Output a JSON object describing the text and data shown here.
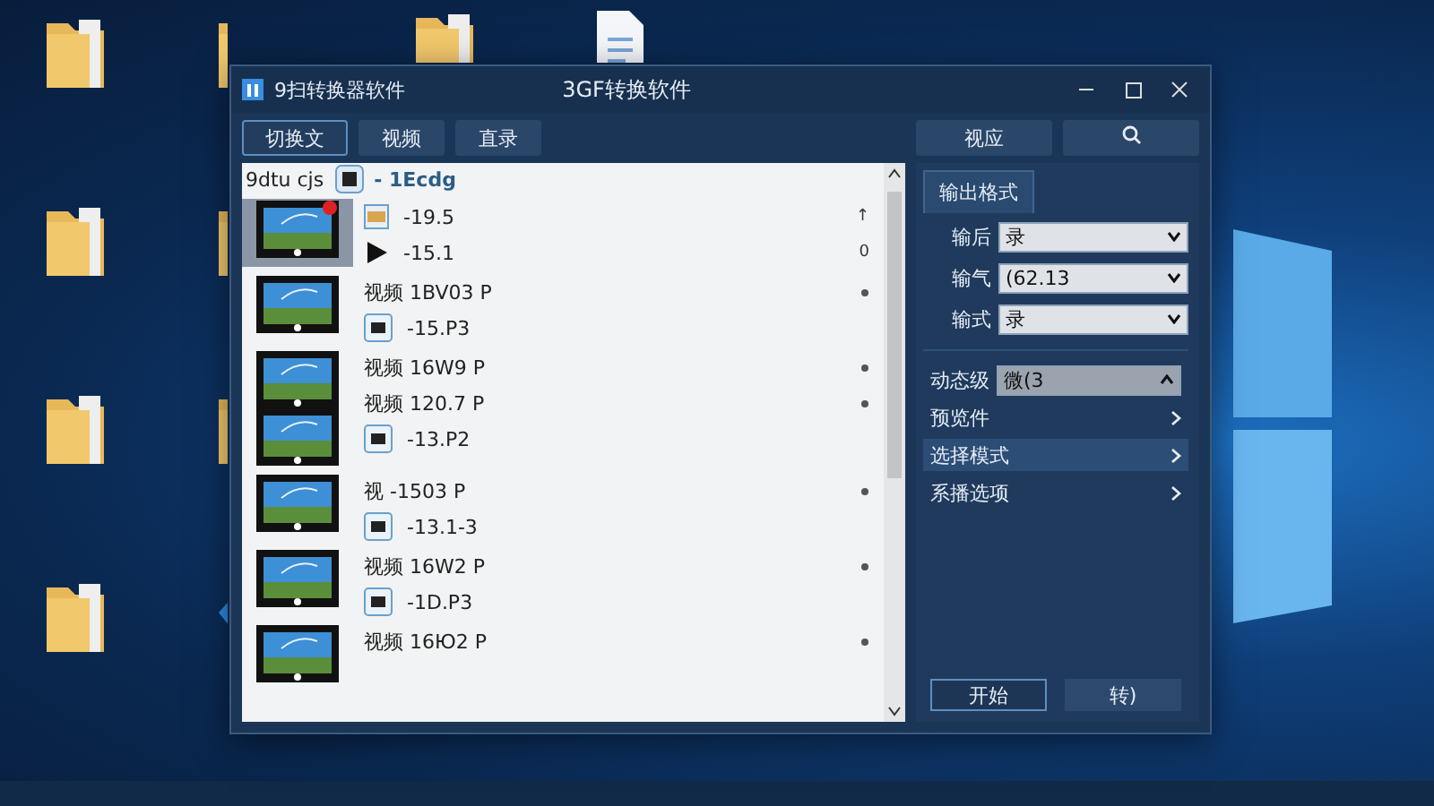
{
  "desktop": {
    "icons": [
      {
        "kind": "folder"
      },
      {
        "kind": "folder"
      },
      {
        "kind": "folder"
      },
      {
        "kind": "folder"
      },
      {
        "kind": "folder"
      },
      {
        "kind": "folder"
      },
      {
        "kind": "folder"
      },
      {
        "kind": "app"
      },
      {
        "kind": "folder"
      },
      {
        "kind": "document"
      }
    ]
  },
  "window": {
    "app_name": "9扫转换器软件",
    "title": "3GF转换软件"
  },
  "toolbar": {
    "tabs": [
      {
        "label": "切换文",
        "selected": true
      },
      {
        "label": "视频",
        "selected": false
      },
      {
        "label": "直录",
        "selected": false
      }
    ],
    "action": "视应"
  },
  "file_list": {
    "header": {
      "column_1": "9dtu cjs",
      "column_2": "- 1Ecdg"
    },
    "items": [
      {
        "selected": true,
        "double_thumbnail": false,
        "badge": true,
        "lines": [
          {
            "kind": "film",
            "text": "-19.5",
            "side": "↑"
          },
          {
            "kind": "play",
            "text": "-15.1",
            "side": "0"
          }
        ]
      },
      {
        "selected": false,
        "double_thumbnail": false,
        "badge": false,
        "lines": [
          {
            "kind": "title",
            "text": "视频 1BV03 P"
          },
          {
            "kind": "meta",
            "text": "-15.P3"
          }
        ]
      },
      {
        "selected": false,
        "double_thumbnail": true,
        "badge": false,
        "lines": [
          {
            "kind": "title",
            "text": "视频 16W9 P"
          },
          {
            "kind": "title",
            "text": "视频 120.7 P"
          },
          {
            "kind": "meta",
            "text": "-13.P2"
          }
        ]
      },
      {
        "selected": false,
        "double_thumbnail": false,
        "badge": false,
        "lines": [
          {
            "kind": "title",
            "text": "视 -1503 P"
          },
          {
            "kind": "meta",
            "text": "-13.1-3"
          }
        ]
      },
      {
        "selected": false,
        "double_thumbnail": false,
        "badge": false,
        "lines": [
          {
            "kind": "title",
            "text": "视频 16W2 P"
          },
          {
            "kind": "meta",
            "text": "-1D.P3"
          }
        ]
      },
      {
        "selected": false,
        "double_thumbnail": false,
        "badge": false,
        "lines": [
          {
            "kind": "title",
            "text": "视频 16Ю2 P"
          }
        ]
      }
    ]
  },
  "settings": {
    "tab": "输出格式",
    "fields": [
      {
        "label": "输后",
        "value": "录"
      },
      {
        "label": "输气",
        "value": "(62.13"
      },
      {
        "label": "输式",
        "value": "录"
      }
    ],
    "options": [
      {
        "kind": "dropdown",
        "label": "动态级",
        "value": "微(3",
        "expanded": true
      },
      {
        "kind": "link",
        "label": "预览件",
        "selected": false
      },
      {
        "kind": "link",
        "label": "选择模式",
        "selected": true
      },
      {
        "kind": "link",
        "label": "系播选项",
        "selected": false
      }
    ],
    "buttons": [
      {
        "label": "开始",
        "selected": true
      },
      {
        "label": "转)",
        "selected": false
      }
    ]
  }
}
